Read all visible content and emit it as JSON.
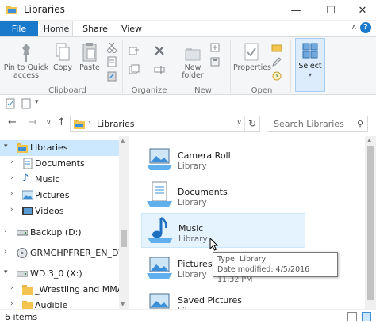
{
  "window": {
    "title": "Libraries",
    "minimize": "—",
    "maximize": "☐",
    "close": "✕"
  },
  "ribbon_tabs": [
    {
      "label": "File"
    },
    {
      "label": "Home"
    },
    {
      "label": "Share"
    },
    {
      "label": "View"
    }
  ],
  "ribbon": {
    "pin": "Pin to Quick access",
    "pin_l1": "Pin to Quick",
    "pin_l2": "access",
    "copy": "Copy",
    "paste": "Paste",
    "new_folder_l1": "New",
    "new_folder_l2": "folder",
    "properties": "Properties",
    "select": "Select",
    "groups": {
      "clipboard": "Clipboard",
      "organize": "Organize",
      "new": "New",
      "open": "Open"
    }
  },
  "address": {
    "back": "←",
    "forward": "→",
    "recent": "∨",
    "up": "↑",
    "crumb": "Libraries",
    "refresh": "↻"
  },
  "search": {
    "placeholder": "Search Libraries"
  },
  "nav_pane": [
    {
      "label": "Libraries",
      "expanded": true,
      "selected": true,
      "indent": 0,
      "icon": "libraries-icon"
    },
    {
      "label": "Documents",
      "indent": 1,
      "icon": "documents-icon"
    },
    {
      "label": "Music",
      "indent": 1,
      "icon": "music-icon"
    },
    {
      "label": "Pictures",
      "indent": 1,
      "icon": "pictures-icon"
    },
    {
      "label": "Videos",
      "indent": 1,
      "icon": "videos-icon"
    },
    {
      "label": "Backup (D:)",
      "indent": 0,
      "icon": "drive-icon"
    },
    {
      "label": "GRMCHPFRER_EN_DVD (I",
      "indent": 0,
      "icon": "dvd-drive-icon"
    },
    {
      "label": "WD 3_0 (X:)",
      "expanded": true,
      "indent": 0,
      "icon": "drive-icon"
    },
    {
      "label": "_Wrestling and MMA",
      "indent": 1,
      "icon": "folder-icon"
    },
    {
      "label": "Audible",
      "indent": 1,
      "icon": "folder-icon"
    }
  ],
  "libraries": [
    {
      "name": "Camera Roll",
      "type": "Library",
      "icon": "camera-roll-icon"
    },
    {
      "name": "Documents",
      "type": "Library",
      "icon": "documents-library-icon"
    },
    {
      "name": "Music",
      "type": "Library",
      "icon": "music-library-icon",
      "hover": true
    },
    {
      "name": "Pictures",
      "type": "Library",
      "icon": "pictures-library-icon"
    },
    {
      "name": "Saved Pictures",
      "type": "Library",
      "icon": "saved-pictures-icon"
    }
  ],
  "tooltip": {
    "line1": "Type: Library",
    "line2": "Date modified: 4/5/2016 11:32 PM"
  },
  "status": {
    "count": "6 items"
  },
  "colors": {
    "accent": "#1979ca",
    "selection": "#cce8ff",
    "hover": "#e5f3ff",
    "folder": "#f4c451"
  }
}
